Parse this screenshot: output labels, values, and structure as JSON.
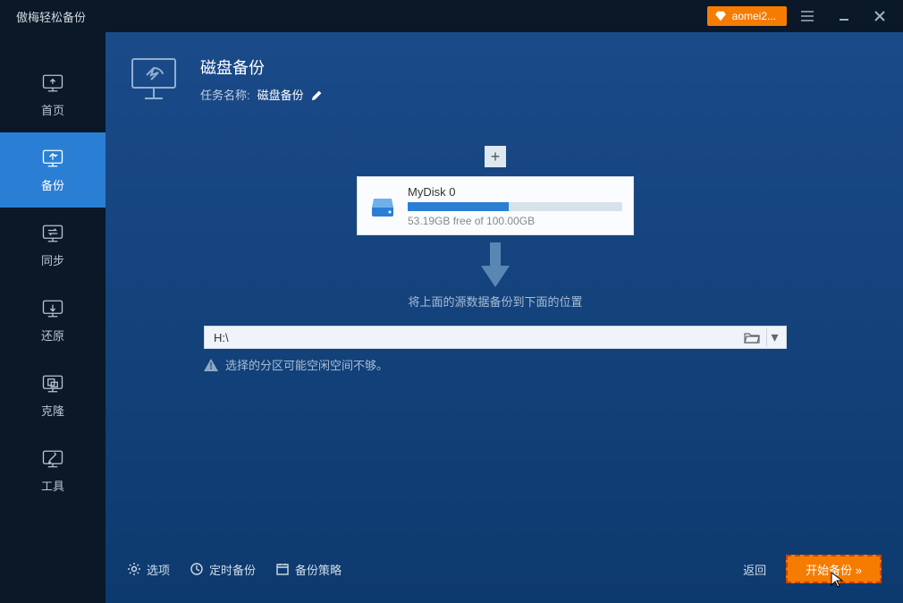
{
  "titlebar": {
    "title": "傲梅轻松备份",
    "badge": "aomei2..."
  },
  "sidebar": {
    "items": [
      {
        "label": "首页"
      },
      {
        "label": "备份"
      },
      {
        "label": "同步"
      },
      {
        "label": "还原"
      },
      {
        "label": "克隆"
      },
      {
        "label": "工具"
      }
    ]
  },
  "header": {
    "title": "磁盘备份",
    "task_label": "任务名称:",
    "task_value": "磁盘备份"
  },
  "disk": {
    "name": "MyDisk 0",
    "free_text": "53.19GB free of 100.00GB",
    "fill_pct": 47
  },
  "instruction": "将上面的源数据备份到下面的位置",
  "destination": {
    "path": "H:\\"
  },
  "warning": "选择的分区可能空闲空间不够。",
  "footer": {
    "options": "选项",
    "schedule": "定时备份",
    "strategy": "备份策略",
    "back": "返回",
    "start": "开始备份 »"
  }
}
